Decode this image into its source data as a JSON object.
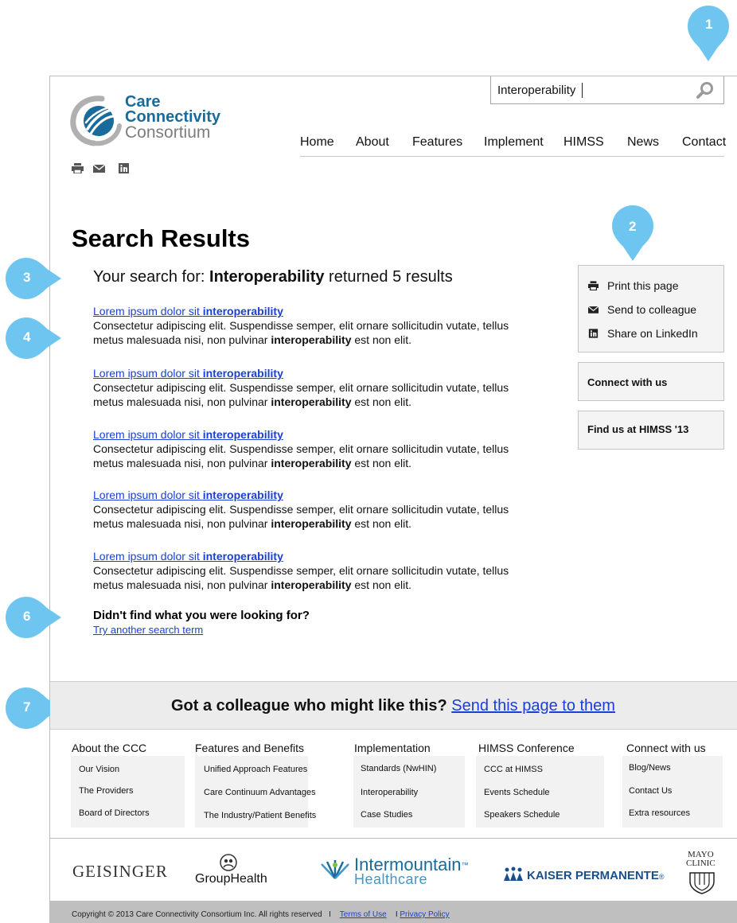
{
  "markers": [
    "1",
    "2",
    "3",
    "4",
    "6",
    "7"
  ],
  "search": {
    "value": "Interoperability",
    "button": "search-icon"
  },
  "logo": {
    "line1": "Care",
    "line2": "Connectivity",
    "line3": "Consortium"
  },
  "nav": [
    "Home",
    "About",
    "Features",
    "Implement",
    "HIMSS",
    "News",
    "Contact"
  ],
  "tools": [
    "print-icon",
    "mail-icon",
    "linkedin-icon"
  ],
  "main": {
    "title": "Search Results",
    "summary_prefix": "Your search for: ",
    "summary_term": "Interoperability",
    "summary_suffix": " returned 5 results",
    "results": [
      {
        "title": "Lorem ipsum dolor sit ",
        "title_bold": "interoperability",
        "line1": "Consectetur adipiscing elit. Suspendisse semper, elit ornare sollicitudin vutate, tellus",
        "line2_pre": "metus malesuada nisi, non pulvinar ",
        "line2_bold": "interoperability",
        "line2_post": " est non elit."
      },
      {
        "title": "Lorem ipsum dolor sit ",
        "title_bold": "interoperability",
        "line1": "Consectetur adipiscing elit. Suspendisse semper, elit ornare sollicitudin vutate, tellus",
        "line2_pre": "metus malesuada nisi, non pulvinar ",
        "line2_bold": "interoperability",
        "line2_post": " est non elit."
      },
      {
        "title": "Lorem ipsum dolor sit ",
        "title_bold": "interoperability",
        "line1": "Consectetur adipiscing elit. Suspendisse semper, elit ornare sollicitudin vutate, tellus",
        "line2_pre": "metus malesuada nisi, non pulvinar ",
        "line2_bold": "interoperability",
        "line2_post": " est non elit."
      },
      {
        "title": "Lorem ipsum dolor sit ",
        "title_bold": "interoperability",
        "line1": "Consectetur adipiscing elit. Suspendisse semper, elit ornare sollicitudin vutate, tellus",
        "line2_pre": "metus malesuada nisi, non pulvinar ",
        "line2_bold": "interoperability",
        "line2_post": " est non elit."
      },
      {
        "title": "Lorem ipsum dolor sit ",
        "title_bold": "interoperability",
        "line1": "Consectetur adipiscing elit. Suspendisse semper, elit ornare sollicitudin vutate, tellus",
        "line2_pre": "metus malesuada nisi, non pulvinar ",
        "line2_bold": "interoperability",
        "line2_post": " est non elit."
      }
    ],
    "not_found": "Didn't find what you were looking for?",
    "try_link": "Try another search term"
  },
  "sidebar": {
    "actions": [
      {
        "icon": "print-icon",
        "label": "Print this page"
      },
      {
        "icon": "mail-icon",
        "label": "Send to colleague"
      },
      {
        "icon": "linkedin-icon",
        "label": "Share on LinkedIn"
      }
    ],
    "connect": "Connect with us",
    "himss": "Find us at HIMSS '13"
  },
  "share_band": {
    "text": "Got a colleague who might like this? ",
    "link": "Send this page to them"
  },
  "footer": {
    "columns": [
      {
        "title": "About the CCC",
        "links": [
          "Our Vision",
          "The Providers",
          "Board of Directors"
        ]
      },
      {
        "title": "Features and Benefits",
        "links": [
          "Unified Approach Features",
          "Care Continuum Advantages",
          "The Industry/Patient Benefits"
        ]
      },
      {
        "title": "Implementation",
        "links": [
          "Standards (NwHIN)",
          "Interoperability",
          "Case Studies"
        ]
      },
      {
        "title": "HIMSS Conference",
        "links": [
          "CCC at HIMSS",
          "Events Schedule",
          "Speakers Schedule"
        ]
      },
      {
        "title": "Connect with us",
        "links": [
          "Blog/News",
          "Contact Us",
          "Extra resources"
        ]
      }
    ],
    "partners": {
      "geisinger": "GEISINGER",
      "grouphealth": "GroupHealth",
      "intermountain_1": "Intermountain",
      "intermountain_tm": "™",
      "intermountain_2": "Healthcare",
      "kaiser": "KAISER PERMANENTE",
      "kaiser_mark": "®",
      "mayo_1": "MAYO",
      "mayo_2": "CLINIC"
    },
    "copyright": "Copyright © 2013 Care Connectivity Consortium Inc. All rights reserved",
    "sep1": "I",
    "terms": "Terms of Use",
    "sep2": "I",
    "privacy": "Privacy Policy"
  },
  "colors": {
    "marker": "#6ec6f0",
    "brand_blue": "#1a6b9b",
    "link": "#1a3fd6"
  }
}
